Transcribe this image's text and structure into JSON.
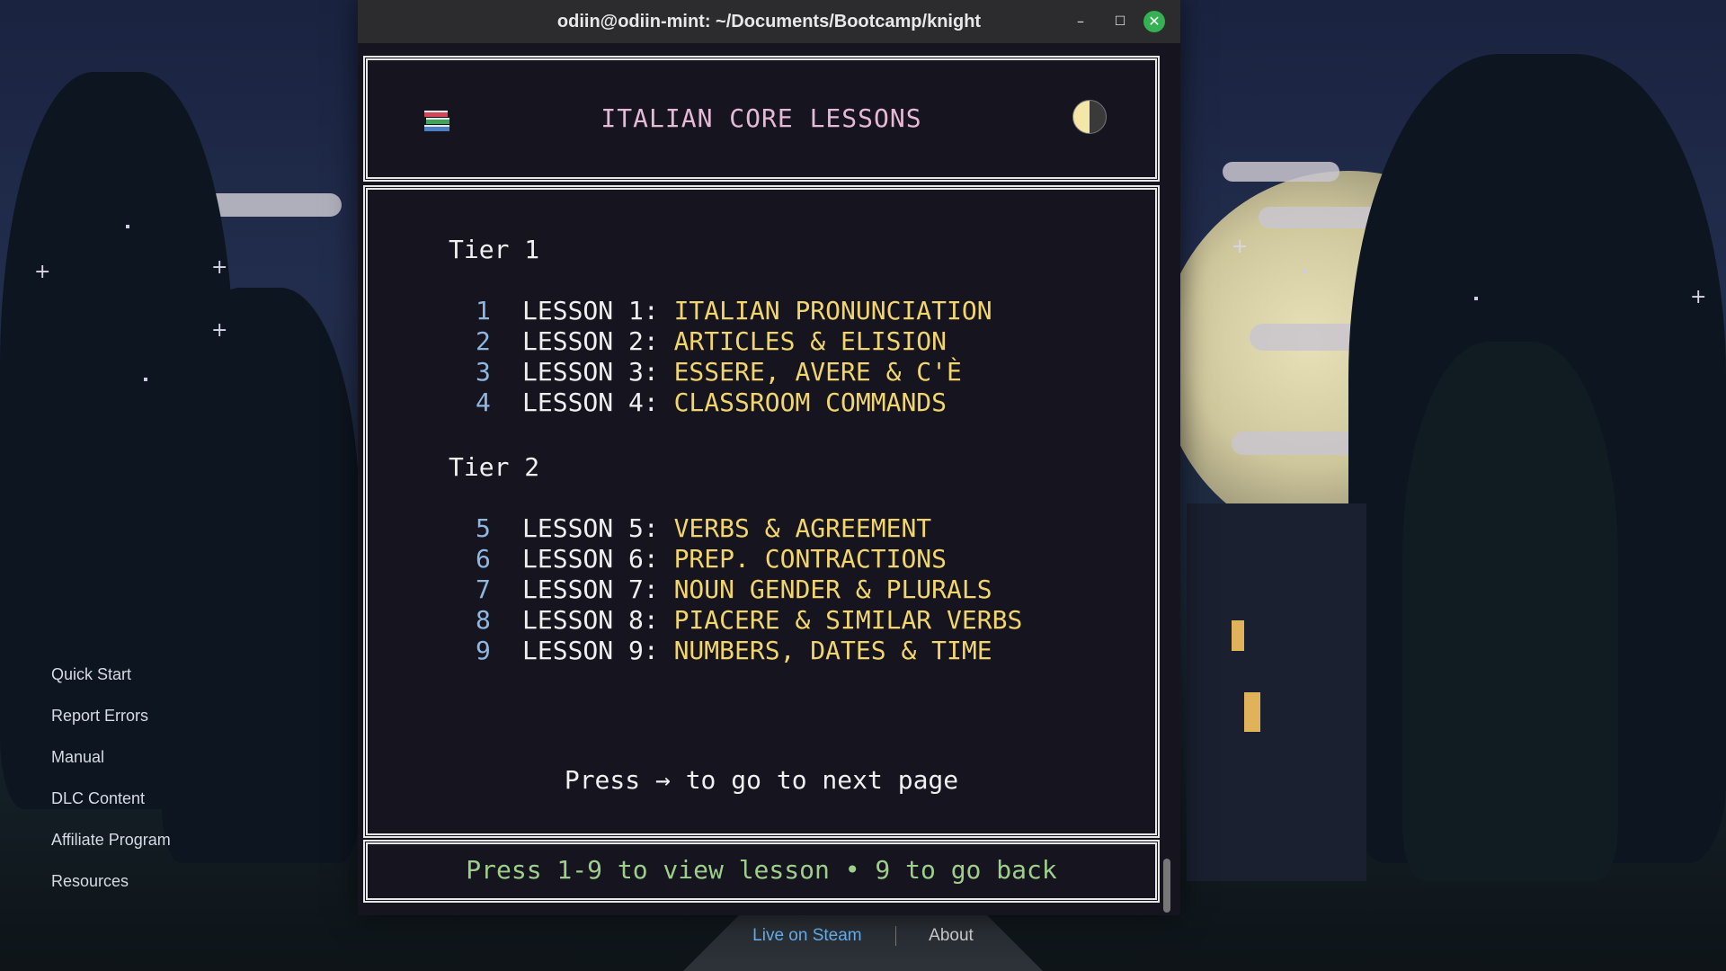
{
  "desktop": {
    "side_links": [
      "Quick Start",
      "Report Errors",
      "Manual",
      "DLC Content",
      "Affiliate Program",
      "Resources"
    ],
    "bottom_bar": {
      "steam": "Live on Steam",
      "about": "About"
    }
  },
  "window": {
    "title": "odiin@odiin-mint: ~/Documents/Bootcamp/knight",
    "minimize": "–",
    "maximize": "☐",
    "close": "✕"
  },
  "terminal": {
    "header_title": "ITALIAN CORE LESSONS",
    "icons": {
      "left": "books-icon",
      "right": "half-moon-icon"
    },
    "tiers": [
      {
        "label": "Tier 1",
        "lessons": [
          {
            "num": "1",
            "label": "LESSON 1:",
            "name": "ITALIAN PRONUNCIATION"
          },
          {
            "num": "2",
            "label": "LESSON 2:",
            "name": "ARTICLES & ELISION"
          },
          {
            "num": "3",
            "label": "LESSON 3:",
            "name": "ESSERE, AVERE & C'È"
          },
          {
            "num": "4",
            "label": "LESSON 4:",
            "name": "CLASSROOM COMMANDS"
          }
        ]
      },
      {
        "label": "Tier 2",
        "lessons": [
          {
            "num": "5",
            "label": "LESSON 5:",
            "name": "VERBS & AGREEMENT"
          },
          {
            "num": "6",
            "label": "LESSON 6:",
            "name": "PREP. CONTRACTIONS"
          },
          {
            "num": "7",
            "label": "LESSON 7:",
            "name": "NOUN GENDER & PLURALS"
          },
          {
            "num": "8",
            "label": "LESSON 8:",
            "name": "PIACERE & SIMILAR VERBS"
          },
          {
            "num": "9",
            "label": "LESSON 9:",
            "name": "NUMBERS, DATES & TIME"
          }
        ]
      }
    ],
    "next_hint": "Press → to go to next page",
    "footer": "Press 1-9 to view lesson • 9 to go back"
  },
  "colors": {
    "title_pink": "#e6b9d6",
    "lesson_yellow": "#f2d66b",
    "number_blue": "#8fb7e0",
    "footer_green": "#9ecf8a",
    "close_green": "#35b052",
    "steam_blue": "#6ab2f0"
  }
}
